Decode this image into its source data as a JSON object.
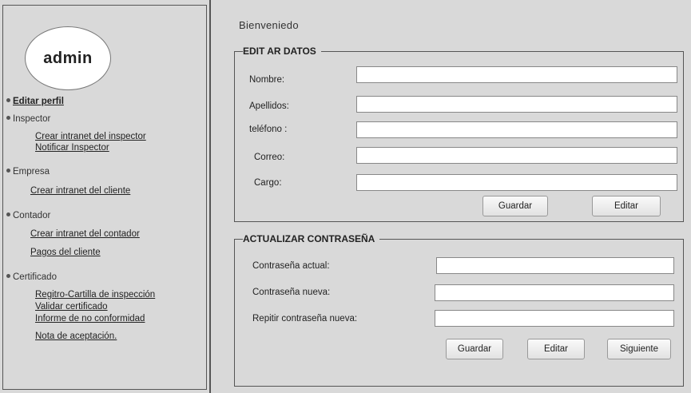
{
  "user": {
    "name": "admin"
  },
  "sidebar": {
    "editar_perfil": "Editar perfil",
    "inspector": {
      "label": "Inspector",
      "links": [
        "Crear intranet del inspector",
        "Notificar Inspector"
      ]
    },
    "empresa": {
      "label": "Empresa",
      "links": [
        "Crear intranet del cliente"
      ]
    },
    "contador": {
      "label": "Contador",
      "links": [
        "Crear intranet del contador",
        "Pagos del cliente"
      ]
    },
    "certificado": {
      "label": "Certificado",
      "links": [
        "Regitro-Cartilla de inspección",
        "Validar certificado",
        "Informe de no conformidad",
        "Nota de aceptación."
      ]
    }
  },
  "main": {
    "welcome": "Bienveniedo",
    "editar_datos": {
      "legend": "EDIT AR DATOS",
      "fields": [
        {
          "label": "Nombre:",
          "value": ""
        },
        {
          "label": "Apellidos:",
          "value": ""
        },
        {
          "label": "teléfono :",
          "value": ""
        },
        {
          "label": "Correo:",
          "value": ""
        },
        {
          "label": "Cargo:",
          "value": ""
        }
      ],
      "buttons": {
        "save": "Guardar",
        "edit": "Editar"
      }
    },
    "actualizar_contrasena": {
      "legend": "ACTUALIZAR CONTRASEÑA",
      "fields": [
        {
          "label": "Contraseña actual:",
          "value": ""
        },
        {
          "label": "Contraseña nueva:",
          "value": ""
        },
        {
          "label": "Repitir contraseña nueva:",
          "value": ""
        }
      ],
      "buttons": {
        "save": "Guardar",
        "edit": "Editar",
        "next": "Siguiente"
      }
    }
  }
}
